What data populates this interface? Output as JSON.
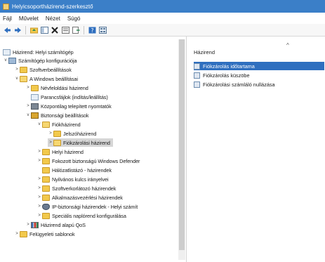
{
  "window": {
    "title": "Helyicsoportházirend-szerkesztő"
  },
  "menu": [
    "Fájl",
    "Művelet",
    "Nézet",
    "Súgó"
  ],
  "toolbar": {
    "buttons": [
      "back-icon",
      "forward-icon",
      "up-folder-icon",
      "show-tree-icon",
      "delete-icon",
      "properties-icon",
      "export-icon",
      "help-icon",
      "view-icon"
    ]
  },
  "tree": {
    "root": "Házirend: Helyi számítógép",
    "items": [
      {
        "label": "Számítógép konfigurációja",
        "expander": "v"
      },
      {
        "label": "Szoftverbeállítások",
        "expander": ">"
      },
      {
        "label": "A Windows beállításai",
        "expander": "v"
      },
      {
        "label": "Névfeloldási házirend",
        "expander": ">"
      },
      {
        "label": "Parancsfájlok (indítás/leállítás)",
        "expander": ""
      },
      {
        "label": "Központilag telepített nyomtatók",
        "expander": ">"
      },
      {
        "label": "Biztonsági beállítások",
        "expander": "v"
      },
      {
        "label": "Fiókházirend",
        "expander": "v"
      },
      {
        "label": "Jelszóházirend",
        "expander": ">"
      },
      {
        "label": "Fiókzárolási házirend",
        "expander": ">"
      },
      {
        "label": "Helyi házirend",
        "expander": ">"
      },
      {
        "label": "Fokozott biztonságú Windows Defender",
        "expander": ">"
      },
      {
        "label": "Hálózatlistázó - házirendek",
        "expander": ""
      },
      {
        "label": "Nyilvános kulcs irányelvei",
        "expander": ">"
      },
      {
        "label": "Szoftverkorlátozó házirendek",
        "expander": ">"
      },
      {
        "label": "Alkalmazásvezérlési házirendek",
        "expander": ">"
      },
      {
        "label": "IP-biztonsági házirendek - Helyi számít",
        "expander": ">"
      },
      {
        "label": "Speciális naplórend konfigurálása",
        "expander": ">"
      },
      {
        "label": "Házirend alapú QoS",
        "expander": ">"
      },
      {
        "label": "Felügyeleti sablonok",
        "expander": ">"
      }
    ]
  },
  "details": {
    "collapse_glyph": "^",
    "header": "Házirend",
    "items": [
      {
        "label": "Fiókzárolás időtartama"
      },
      {
        "label": "Fiókzárolás küszöbe"
      },
      {
        "label": "Fiókzárolási számláló nullázása"
      }
    ]
  }
}
